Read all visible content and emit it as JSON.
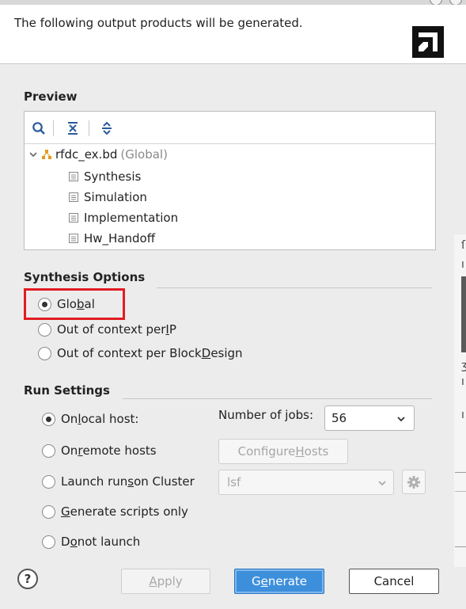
{
  "header": {
    "message": "The following output products will be generated.",
    "logo_icon": "amd-logo-icon"
  },
  "preview": {
    "title": "Preview",
    "toolbar": {
      "search_icon": "search-icon",
      "collapse_icon": "collapse-all-icon",
      "expand_icon": "expand-all-icon"
    },
    "tree": {
      "root_name": "rfdc_ex.bd",
      "root_scope": "(Global)",
      "children": [
        "Synthesis",
        "Simulation",
        "Implementation",
        "Hw_Handoff"
      ]
    }
  },
  "synthesis_options": {
    "title": "Synthesis Options",
    "options": [
      {
        "pre": "Glo",
        "mn": "b",
        "post": "al",
        "selected": true
      },
      {
        "pre": "Out of context per ",
        "mn": "I",
        "post": "P",
        "selected": false
      },
      {
        "pre": "Out of context per Block ",
        "mn": "D",
        "post": "esign",
        "selected": false
      }
    ],
    "highlight_color": "#e21b23"
  },
  "run_settings": {
    "title": "Run Settings",
    "options": [
      {
        "pre": "On ",
        "mn": "l",
        "post": "ocal host:",
        "selected": true
      },
      {
        "pre": "On ",
        "mn": "r",
        "post": "emote hosts",
        "selected": false
      },
      {
        "pre": "Launch run",
        "mn": "s",
        "post": " on Cluster",
        "selected": false
      },
      {
        "pre": "",
        "mn": "G",
        "post": "enerate scripts only",
        "selected": false
      },
      {
        "pre": "D",
        "mn": "o",
        "post": " not launch",
        "selected": false
      }
    ],
    "jobs_label_pre": "Number of ",
    "jobs_label_mn": "j",
    "jobs_label_post": "obs:",
    "jobs_value": "56",
    "configure_pre": "Configure ",
    "configure_mn": "H",
    "configure_post": "osts",
    "cluster_value": "lsf"
  },
  "footer": {
    "help_label": "?",
    "apply_mn": "A",
    "apply_post": "pply",
    "generate_pre": "G",
    "generate_mn": "e",
    "generate_post": "nerate",
    "cancel_label": "Cancel",
    "primary_color": "#3d8fdb"
  }
}
